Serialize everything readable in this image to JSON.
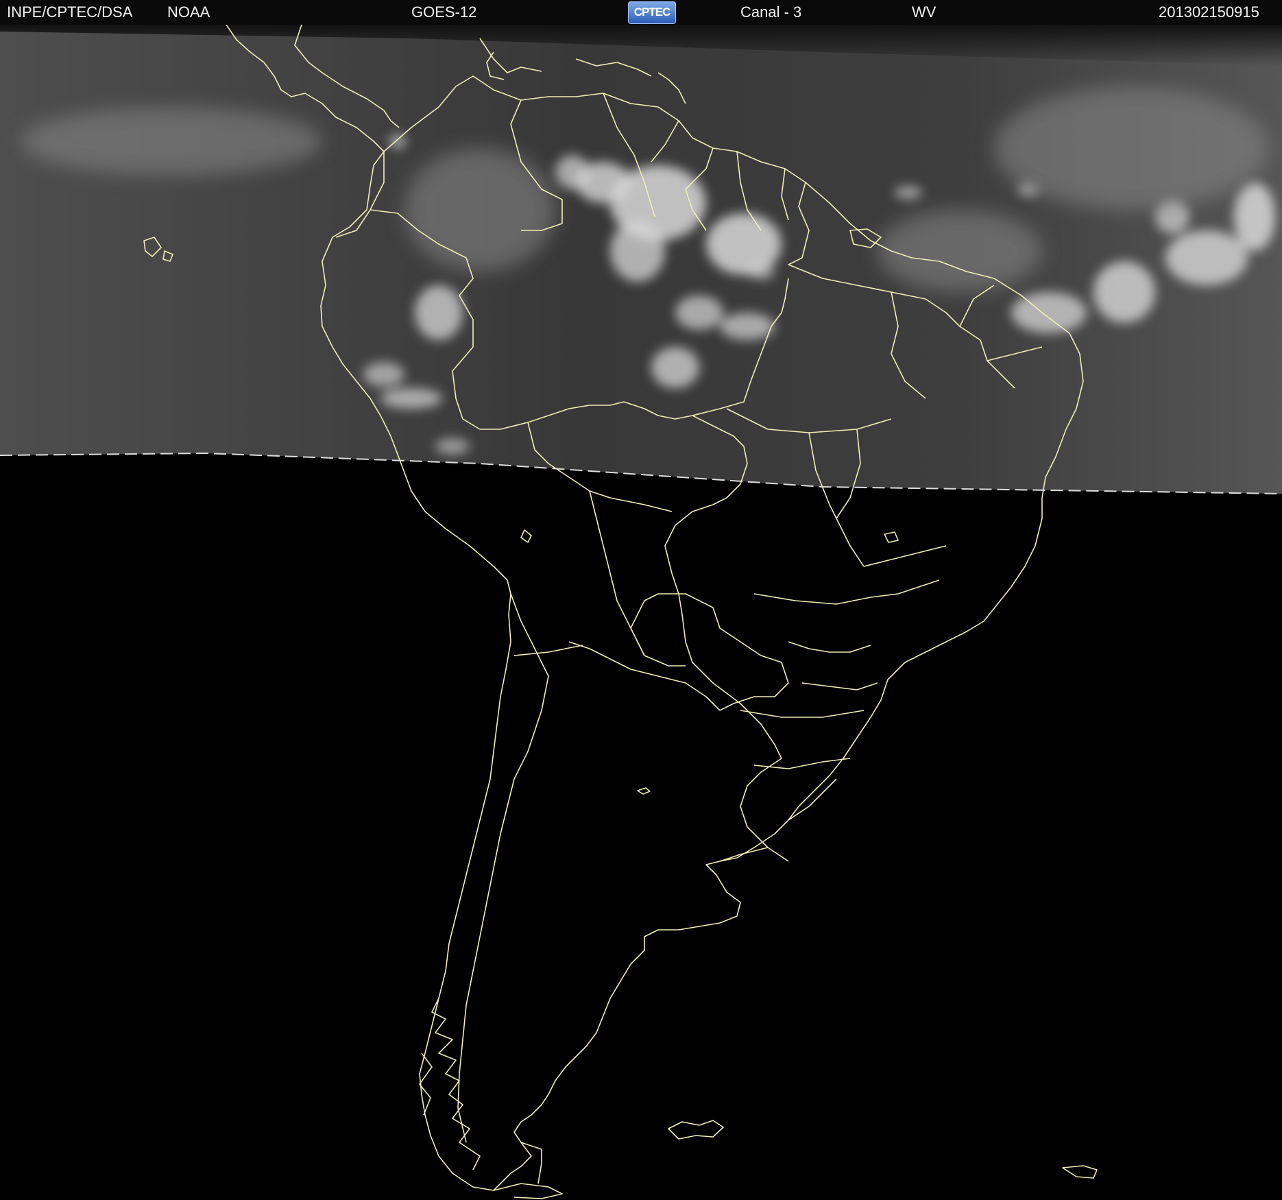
{
  "header": {
    "agency": "INPE/CPTEC/DSA",
    "source": "NOAA",
    "satellite": "GOES-12",
    "logo_text": "CPTEC",
    "channel": "Canal - 3",
    "band": "WV",
    "timestamp": "201302150915"
  },
  "colors": {
    "coastline": "#f0eeb8",
    "night_side": "#000000",
    "day_side": "#4a4a4a",
    "cloud": "#dcdcdc"
  },
  "map": {
    "region": "South America",
    "image_type": "water vapor satellite image"
  }
}
